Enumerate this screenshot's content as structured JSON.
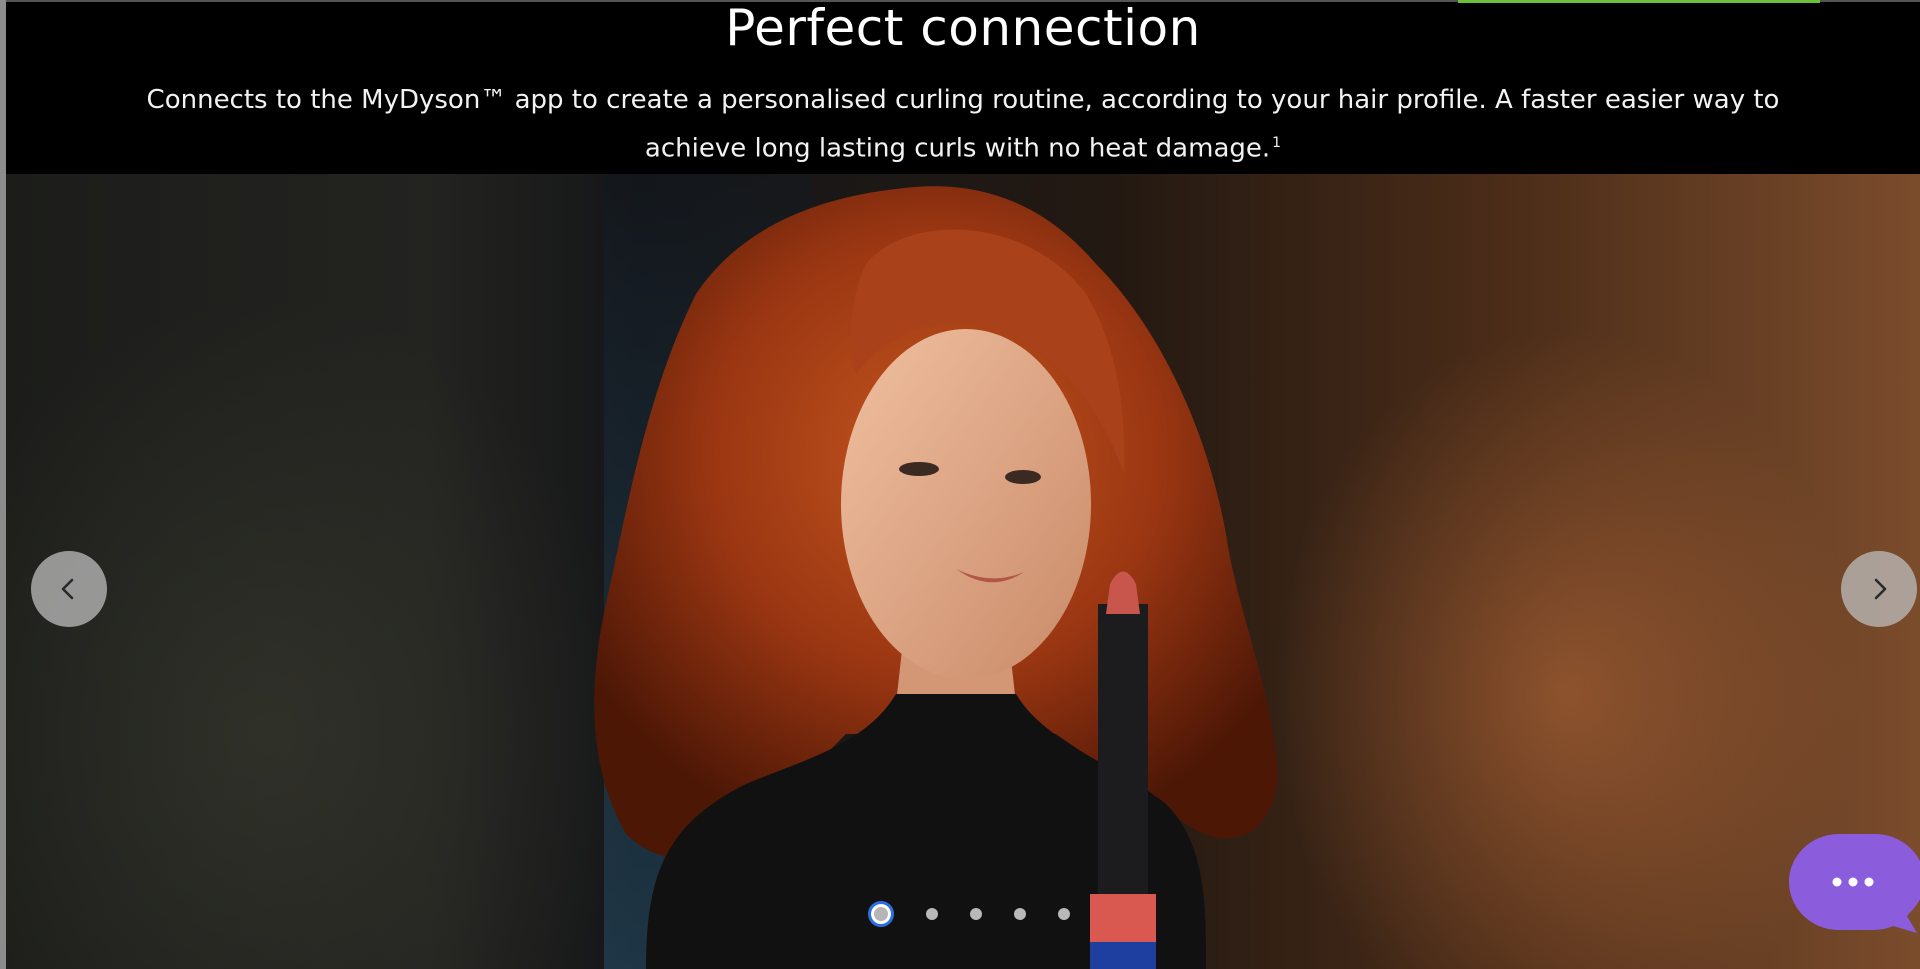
{
  "section": {
    "title": "Perfect connection",
    "description": "Connects to the MyDyson™ app to create a personalised curling routine, according to your hair profile. A faster easier way to achieve long lasting curls with no heat damage.",
    "footnote": "1"
  },
  "carousel": {
    "slide_count": 5,
    "active_index": 0,
    "image_alt": "Woman with long red curls holding a hair styler"
  },
  "colors": {
    "progress_accent": "#6cbf3a",
    "chat_button": "#8b5cdc",
    "active_dot_ring": "#2d6fe0"
  },
  "icons": {
    "prev": "chevron-left-icon",
    "next": "chevron-right-icon",
    "chat": "chat-bubble-icon"
  }
}
